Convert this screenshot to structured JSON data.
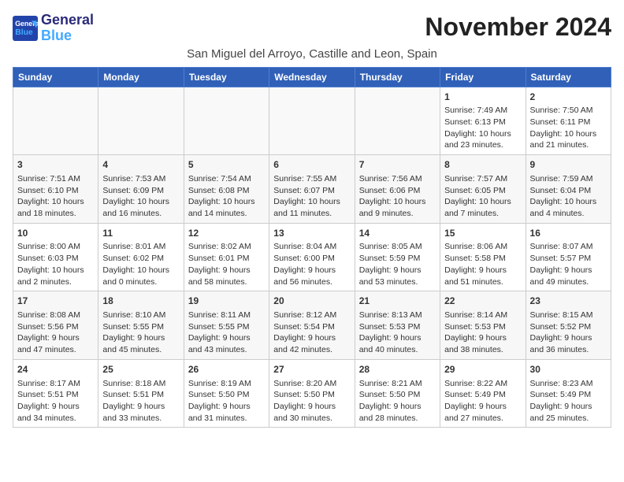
{
  "header": {
    "logo_line1": "General",
    "logo_line2": "Blue",
    "month_year": "November 2024",
    "location": "San Miguel del Arroyo, Castille and Leon, Spain"
  },
  "weekdays": [
    "Sunday",
    "Monday",
    "Tuesday",
    "Wednesday",
    "Thursday",
    "Friday",
    "Saturday"
  ],
  "weeks": [
    [
      {
        "day": "",
        "info": ""
      },
      {
        "day": "",
        "info": ""
      },
      {
        "day": "",
        "info": ""
      },
      {
        "day": "",
        "info": ""
      },
      {
        "day": "",
        "info": ""
      },
      {
        "day": "1",
        "info": "Sunrise: 7:49 AM\nSunset: 6:13 PM\nDaylight: 10 hours\nand 23 minutes."
      },
      {
        "day": "2",
        "info": "Sunrise: 7:50 AM\nSunset: 6:11 PM\nDaylight: 10 hours\nand 21 minutes."
      }
    ],
    [
      {
        "day": "3",
        "info": "Sunrise: 7:51 AM\nSunset: 6:10 PM\nDaylight: 10 hours\nand 18 minutes."
      },
      {
        "day": "4",
        "info": "Sunrise: 7:53 AM\nSunset: 6:09 PM\nDaylight: 10 hours\nand 16 minutes."
      },
      {
        "day": "5",
        "info": "Sunrise: 7:54 AM\nSunset: 6:08 PM\nDaylight: 10 hours\nand 14 minutes."
      },
      {
        "day": "6",
        "info": "Sunrise: 7:55 AM\nSunset: 6:07 PM\nDaylight: 10 hours\nand 11 minutes."
      },
      {
        "day": "7",
        "info": "Sunrise: 7:56 AM\nSunset: 6:06 PM\nDaylight: 10 hours\nand 9 minutes."
      },
      {
        "day": "8",
        "info": "Sunrise: 7:57 AM\nSunset: 6:05 PM\nDaylight: 10 hours\nand 7 minutes."
      },
      {
        "day": "9",
        "info": "Sunrise: 7:59 AM\nSunset: 6:04 PM\nDaylight: 10 hours\nand 4 minutes."
      }
    ],
    [
      {
        "day": "10",
        "info": "Sunrise: 8:00 AM\nSunset: 6:03 PM\nDaylight: 10 hours\nand 2 minutes."
      },
      {
        "day": "11",
        "info": "Sunrise: 8:01 AM\nSunset: 6:02 PM\nDaylight: 10 hours\nand 0 minutes."
      },
      {
        "day": "12",
        "info": "Sunrise: 8:02 AM\nSunset: 6:01 PM\nDaylight: 9 hours\nand 58 minutes."
      },
      {
        "day": "13",
        "info": "Sunrise: 8:04 AM\nSunset: 6:00 PM\nDaylight: 9 hours\nand 56 minutes."
      },
      {
        "day": "14",
        "info": "Sunrise: 8:05 AM\nSunset: 5:59 PM\nDaylight: 9 hours\nand 53 minutes."
      },
      {
        "day": "15",
        "info": "Sunrise: 8:06 AM\nSunset: 5:58 PM\nDaylight: 9 hours\nand 51 minutes."
      },
      {
        "day": "16",
        "info": "Sunrise: 8:07 AM\nSunset: 5:57 PM\nDaylight: 9 hours\nand 49 minutes."
      }
    ],
    [
      {
        "day": "17",
        "info": "Sunrise: 8:08 AM\nSunset: 5:56 PM\nDaylight: 9 hours\nand 47 minutes."
      },
      {
        "day": "18",
        "info": "Sunrise: 8:10 AM\nSunset: 5:55 PM\nDaylight: 9 hours\nand 45 minutes."
      },
      {
        "day": "19",
        "info": "Sunrise: 8:11 AM\nSunset: 5:55 PM\nDaylight: 9 hours\nand 43 minutes."
      },
      {
        "day": "20",
        "info": "Sunrise: 8:12 AM\nSunset: 5:54 PM\nDaylight: 9 hours\nand 42 minutes."
      },
      {
        "day": "21",
        "info": "Sunrise: 8:13 AM\nSunset: 5:53 PM\nDaylight: 9 hours\nand 40 minutes."
      },
      {
        "day": "22",
        "info": "Sunrise: 8:14 AM\nSunset: 5:53 PM\nDaylight: 9 hours\nand 38 minutes."
      },
      {
        "day": "23",
        "info": "Sunrise: 8:15 AM\nSunset: 5:52 PM\nDaylight: 9 hours\nand 36 minutes."
      }
    ],
    [
      {
        "day": "24",
        "info": "Sunrise: 8:17 AM\nSunset: 5:51 PM\nDaylight: 9 hours\nand 34 minutes."
      },
      {
        "day": "25",
        "info": "Sunrise: 8:18 AM\nSunset: 5:51 PM\nDaylight: 9 hours\nand 33 minutes."
      },
      {
        "day": "26",
        "info": "Sunrise: 8:19 AM\nSunset: 5:50 PM\nDaylight: 9 hours\nand 31 minutes."
      },
      {
        "day": "27",
        "info": "Sunrise: 8:20 AM\nSunset: 5:50 PM\nDaylight: 9 hours\nand 30 minutes."
      },
      {
        "day": "28",
        "info": "Sunrise: 8:21 AM\nSunset: 5:50 PM\nDaylight: 9 hours\nand 28 minutes."
      },
      {
        "day": "29",
        "info": "Sunrise: 8:22 AM\nSunset: 5:49 PM\nDaylight: 9 hours\nand 27 minutes."
      },
      {
        "day": "30",
        "info": "Sunrise: 8:23 AM\nSunset: 5:49 PM\nDaylight: 9 hours\nand 25 minutes."
      }
    ]
  ]
}
